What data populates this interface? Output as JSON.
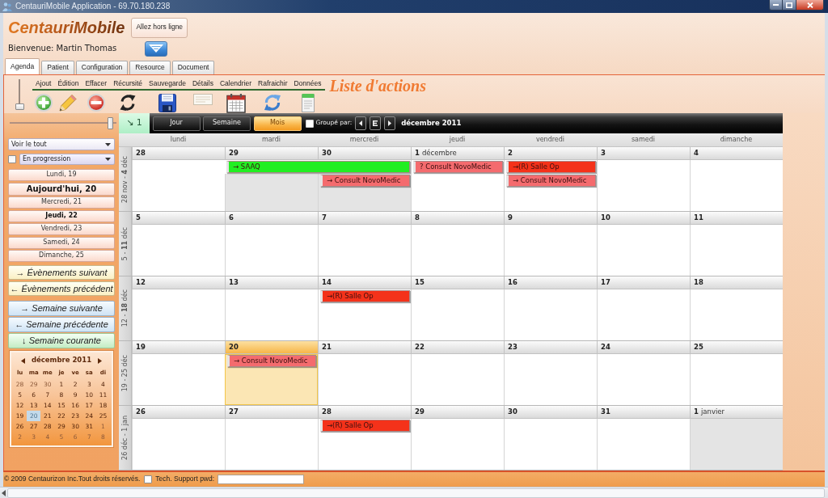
{
  "window": {
    "title": "CentauriMobile Application - 69.70.180.238"
  },
  "header": {
    "logo": "CentauriMobile",
    "offline_button": "Allez hors ligne",
    "welcome": "Bienvenue: Martin Thomas"
  },
  "tabs": [
    {
      "label": "Agenda",
      "selected": true
    },
    {
      "label": "Patient",
      "selected": false
    },
    {
      "label": "Configuration",
      "selected": false
    },
    {
      "label": "Resource",
      "selected": false
    },
    {
      "label": "Document",
      "selected": false
    }
  ],
  "toolbar": {
    "slider": {
      "level": 0
    },
    "actions": [
      {
        "label": "Ajout",
        "kind": "add"
      },
      {
        "label": "Édition",
        "kind": "edit"
      },
      {
        "label": "Effacer",
        "kind": "delete"
      },
      {
        "label": "Récursité",
        "kind": "recurrence"
      },
      {
        "label": "Sauvegarde",
        "kind": "save"
      },
      {
        "label": "Détails",
        "kind": "details"
      },
      {
        "label": "Calendrier",
        "kind": "calendar"
      },
      {
        "label": "Rafraichir",
        "kind": "refresh"
      },
      {
        "label": "Données",
        "kind": "data"
      }
    ],
    "caption": "Liste d'actions"
  },
  "sidebar": {
    "slider": {
      "level": 0.97
    },
    "filter": {
      "value": "Voir le tout"
    },
    "status_filter": {
      "checked": false,
      "value": "En progression"
    },
    "days": [
      {
        "label": "Lundi, 19",
        "kind": "plain"
      },
      {
        "label": "Aujourd'hui, 20",
        "kind": "today"
      },
      {
        "label": "Mercredi, 21",
        "kind": "plain"
      },
      {
        "label": "Jeudi, 22",
        "kind": "bold"
      },
      {
        "label": "Vendredi, 23",
        "kind": "plain"
      },
      {
        "label": "Samedi, 24",
        "kind": "plain"
      },
      {
        "label": "Dimanche, 25",
        "kind": "plain"
      }
    ],
    "event_buttons": [
      {
        "label": "→ Évènements suivant"
      },
      {
        "label": "← Évènements précédent"
      }
    ],
    "week_buttons": [
      {
        "label": "→ Semaine suivante",
        "kind": "nav"
      },
      {
        "label": "← Semaine précédente",
        "kind": "nav"
      },
      {
        "label": "↓ Semaine courante",
        "kind": "current"
      }
    ],
    "mini_calendar": {
      "title": "décembre 2011",
      "weekdays": [
        "lu",
        "ma",
        "me",
        "je",
        "ve",
        "sa",
        "di"
      ],
      "days": [
        {
          "date": "28",
          "muted": true,
          "selected": false
        },
        {
          "date": "29",
          "muted": true,
          "selected": false
        },
        {
          "date": "30",
          "muted": true,
          "selected": false
        },
        {
          "date": "1",
          "muted": false,
          "selected": false
        },
        {
          "date": "2",
          "muted": false,
          "selected": false
        },
        {
          "date": "3",
          "muted": false,
          "selected": false
        },
        {
          "date": "4",
          "muted": false,
          "selected": false
        },
        {
          "date": "5",
          "muted": false,
          "selected": false
        },
        {
          "date": "6",
          "muted": false,
          "selected": false
        },
        {
          "date": "7",
          "muted": false,
          "selected": false
        },
        {
          "date": "8",
          "muted": false,
          "selected": false
        },
        {
          "date": "9",
          "muted": false,
          "selected": false
        },
        {
          "date": "10",
          "muted": false,
          "selected": false
        },
        {
          "date": "11",
          "muted": false,
          "selected": false
        },
        {
          "date": "12",
          "muted": false,
          "selected": false
        },
        {
          "date": "13",
          "muted": false,
          "selected": false
        },
        {
          "date": "14",
          "muted": false,
          "selected": false
        },
        {
          "date": "15",
          "muted": false,
          "selected": false
        },
        {
          "date": "16",
          "muted": false,
          "selected": false
        },
        {
          "date": "17",
          "muted": false,
          "selected": false
        },
        {
          "date": "18",
          "muted": false,
          "selected": false
        },
        {
          "date": "19",
          "muted": false,
          "selected": false
        },
        {
          "date": "20",
          "muted": false,
          "selected": true
        },
        {
          "date": "21",
          "muted": false,
          "selected": false
        },
        {
          "date": "22",
          "muted": false,
          "selected": false
        },
        {
          "date": "23",
          "muted": false,
          "selected": false
        },
        {
          "date": "24",
          "muted": false,
          "selected": false
        },
        {
          "date": "25",
          "muted": false,
          "selected": false
        },
        {
          "date": "26",
          "muted": false,
          "selected": false
        },
        {
          "date": "27",
          "muted": false,
          "selected": false
        },
        {
          "date": "28",
          "muted": false,
          "selected": false
        },
        {
          "date": "29",
          "muted": false,
          "selected": false
        },
        {
          "date": "30",
          "muted": false,
          "selected": false
        },
        {
          "date": "31",
          "muted": false,
          "selected": false
        },
        {
          "date": "1",
          "muted": true,
          "selected": false
        },
        {
          "date": "2",
          "muted": true,
          "selected": false
        },
        {
          "date": "3",
          "muted": true,
          "selected": false
        },
        {
          "date": "4",
          "muted": true,
          "selected": false
        },
        {
          "date": "5",
          "muted": true,
          "selected": false
        },
        {
          "date": "6",
          "muted": true,
          "selected": false
        },
        {
          "date": "7",
          "muted": true,
          "selected": false
        },
        {
          "date": "8",
          "muted": true,
          "selected": false
        }
      ]
    }
  },
  "calendar": {
    "counter": "↘ 1",
    "views": [
      {
        "label": "Jour",
        "selected": false
      },
      {
        "label": "Semaine",
        "selected": false
      },
      {
        "label": "Mois",
        "selected": true
      }
    ],
    "group_by": {
      "label": "Groupé par:",
      "checked": false
    },
    "title": "décembre 2011",
    "weekdays": [
      "lundi",
      "mardi",
      "mercredi",
      "jeudi",
      "vendredi",
      "samedi",
      "dimanche"
    ],
    "weeks": [
      {
        "label": "28 nov - **4** déc",
        "days": [
          {
            "date": "28",
            "shaded": false,
            "today": false
          },
          {
            "date": "29",
            "shaded": true,
            "today": false,
            "events": [
              {
                "title": "→ SAAQ",
                "color": "#22ee22",
                "continues": true
              }
            ]
          },
          {
            "date": "30",
            "shaded": true,
            "today": false,
            "events": [
              {
                "title": "→ Consult NovoMedic",
                "color": "#f46b6e",
                "continues": false
              }
            ]
          },
          {
            "date": "1",
            "month": "décembre",
            "shaded": false,
            "today": false,
            "events": [
              {
                "title": "? Consult NovoMedic",
                "color": "#f46b6e",
                "continues": false
              }
            ]
          },
          {
            "date": "2",
            "shaded": false,
            "today": false,
            "events": [
              {
                "title": "→(R) Salle Op",
                "color": "#f4321a",
                "continues": false
              },
              {
                "title": "→ Consult NovoMedic",
                "color": "#f46b6e",
                "continues": false
              }
            ]
          },
          {
            "date": "3",
            "shaded": false,
            "today": false
          },
          {
            "date": "4",
            "shaded": false,
            "today": false
          }
        ]
      },
      {
        "label": "5 - **11** déc",
        "days": [
          {
            "date": "5",
            "shaded": false,
            "today": false
          },
          {
            "date": "6",
            "shaded": false,
            "today": false
          },
          {
            "date": "7",
            "shaded": false,
            "today": false
          },
          {
            "date": "8",
            "shaded": false,
            "today": false
          },
          {
            "date": "9",
            "shaded": false,
            "today": false
          },
          {
            "date": "10",
            "shaded": false,
            "today": false
          },
          {
            "date": "11",
            "shaded": false,
            "today": false
          }
        ]
      },
      {
        "label": "12 - **18** déc",
        "days": [
          {
            "date": "12",
            "shaded": false,
            "today": false
          },
          {
            "date": "13",
            "shaded": false,
            "today": false
          },
          {
            "date": "14",
            "shaded": false,
            "today": false,
            "events": [
              {
                "title": "→(R) Salle Op",
                "color": "#f4321a",
                "continues": false
              }
            ]
          },
          {
            "date": "15",
            "shaded": false,
            "today": false
          },
          {
            "date": "16",
            "shaded": false,
            "today": false
          },
          {
            "date": "17",
            "shaded": false,
            "today": false
          },
          {
            "date": "18",
            "shaded": false,
            "today": false
          }
        ]
      },
      {
        "label": "19 - 25 déc",
        "days": [
          {
            "date": "19",
            "shaded": false,
            "today": false
          },
          {
            "date": "20",
            "shaded": false,
            "today": true,
            "events": [
              {
                "title": "→ Consult NovoMedic",
                "color": "#f46b6e",
                "continues": false
              }
            ]
          },
          {
            "date": "21",
            "shaded": false,
            "today": false
          },
          {
            "date": "22",
            "shaded": false,
            "today": false
          },
          {
            "date": "23",
            "shaded": false,
            "today": false
          },
          {
            "date": "24",
            "shaded": false,
            "today": false
          },
          {
            "date": "25",
            "shaded": false,
            "today": false
          }
        ]
      },
      {
        "label": "26 déc - 1 jan",
        "days": [
          {
            "date": "26",
            "shaded": false,
            "today": false
          },
          {
            "date": "27",
            "shaded": false,
            "today": false
          },
          {
            "date": "28",
            "shaded": false,
            "today": false,
            "events": [
              {
                "title": "→(R) Salle Op",
                "color": "#f4321a",
                "continues": false
              }
            ]
          },
          {
            "date": "29",
            "shaded": false,
            "today": false
          },
          {
            "date": "30",
            "shaded": false,
            "today": false
          },
          {
            "date": "31",
            "shaded": false,
            "today": false
          },
          {
            "date": "1",
            "month": "janvier",
            "shaded": true,
            "today": false
          }
        ]
      }
    ]
  },
  "footer": {
    "copyright": "© 2009 Centaurizon Inc.Tout droits réservés.",
    "support": {
      "label": "Tech. Support pwd:",
      "checked": false
    }
  }
}
